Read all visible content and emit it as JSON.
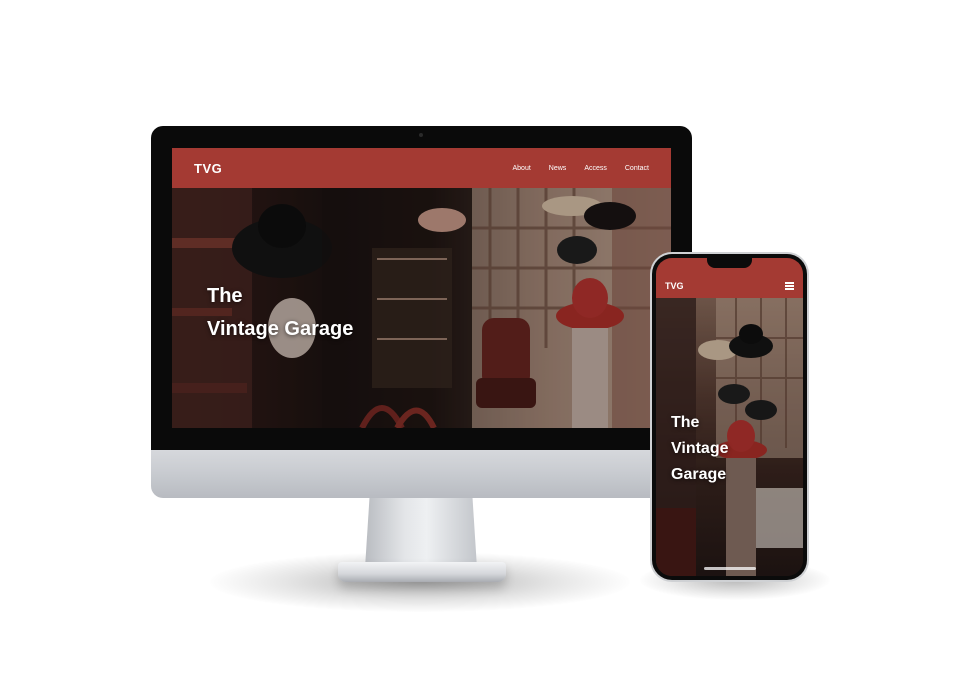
{
  "colors": {
    "brand": "#a43a33",
    "bezel": "#0a0a0a",
    "text": "#ffffff"
  },
  "desktop": {
    "logo": "TVG",
    "nav": [
      "About",
      "News",
      "Access",
      "Contact"
    ],
    "hero_line1": "The",
    "hero_line2": "Vintage Garage"
  },
  "mobile": {
    "logo": "TVG",
    "menu_icon": "menu-icon",
    "hero_line1": "The",
    "hero_line2": "Vintage",
    "hero_line3": "Garage"
  }
}
